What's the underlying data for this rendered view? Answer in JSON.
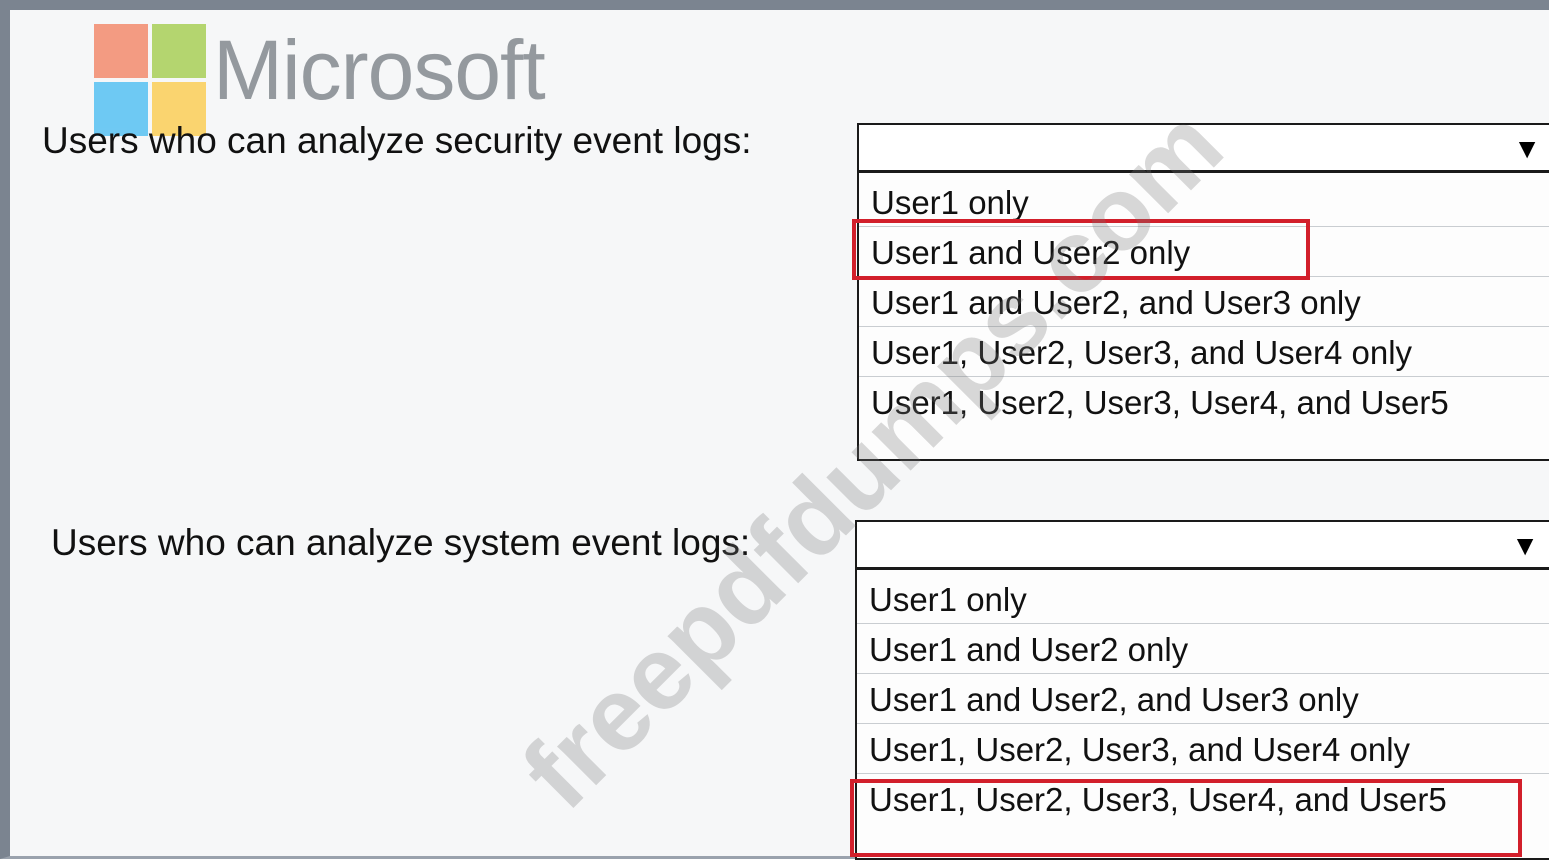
{
  "brand": {
    "name": "Microsoft",
    "logo_colors": [
      "#f25022",
      "#7fba00",
      "#00a4ef",
      "#ffb900"
    ]
  },
  "watermark": "freepdfdumps.com",
  "questions": [
    {
      "label": "Users who can analyze security event logs:",
      "selected": "",
      "options": [
        "User1 only",
        "User1 and User2 only",
        "User1 and User2, and User3 only",
        "User1, User2, User3, and User4 only",
        "User1, User2, User3, User4, and User5"
      ],
      "highlighted_option": "User1 and User2 only"
    },
    {
      "label": "Users who can analyze system event logs:",
      "selected": "",
      "options": [
        "User1 only",
        "User1 and User2 only",
        "User1 and User2, and User3 only",
        "User1, User2, User3, and User4 only",
        "User1, User2, User3, User4, and User5"
      ],
      "highlighted_option": "User1, User2, User3, User4, and User5"
    }
  ],
  "icons": {
    "dropdown_arrow": "▼"
  },
  "colors": {
    "highlight": "#d21f2b",
    "frame": "#7b8490"
  }
}
